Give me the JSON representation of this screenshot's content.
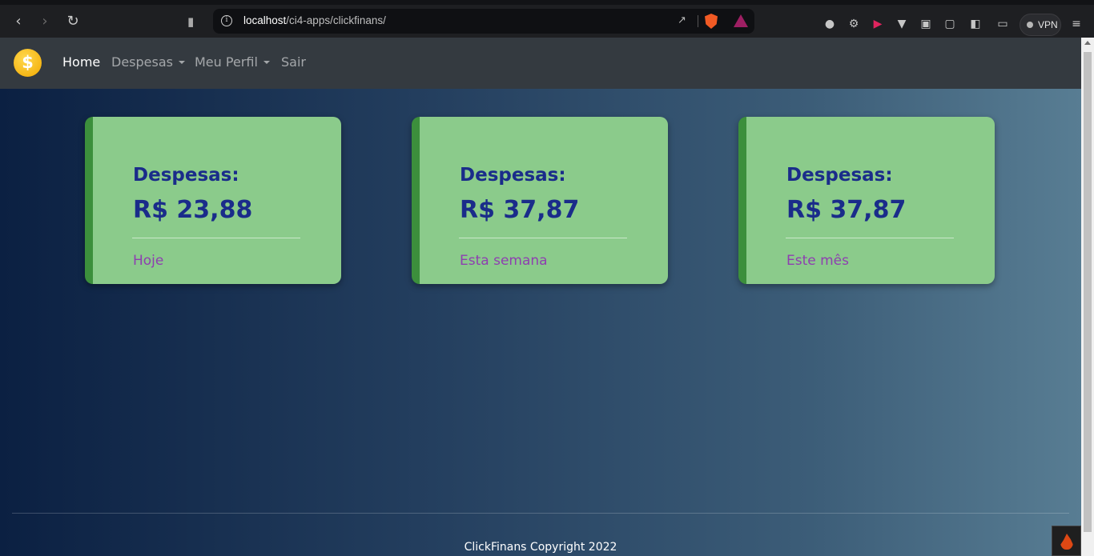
{
  "browser": {
    "url_host": "localhost",
    "url_path": "/ci4-apps/clickfinans/",
    "vpn_label": "VPN",
    "icons": [
      "back-icon",
      "forward-icon",
      "reload-icon",
      "bookmark-icon",
      "site-info-icon",
      "share-icon",
      "brave-shield-icon",
      "brave-rewards-icon",
      "extension-icon",
      "settings-icon",
      "media-icon",
      "vee-icon",
      "camera-icon",
      "puzzle-icon",
      "sidebar-icon",
      "wallet-icon",
      "menu-icon"
    ]
  },
  "navbar": {
    "logo_symbol": "$",
    "links": [
      {
        "label": "Home",
        "active": true,
        "dropdown": false
      },
      {
        "label": "Despesas",
        "active": false,
        "dropdown": true
      },
      {
        "label": "Meu Perfil",
        "active": false,
        "dropdown": true
      },
      {
        "label": "Sair",
        "active": false,
        "dropdown": false
      }
    ]
  },
  "cards": [
    {
      "title": "Despesas:",
      "value": "R$ 23,88",
      "period": "Hoje"
    },
    {
      "title": "Despesas:",
      "value": "R$ 37,87",
      "period": "Esta semana"
    },
    {
      "title": "Despesas:",
      "value": "R$ 37,87",
      "period": "Este mês"
    }
  ],
  "footer": {
    "text": "ClickFinans Copyright 2022"
  },
  "colors": {
    "card_background": "#8bcb8b",
    "card_accent": "#3c8f3c",
    "card_text": "#1a2c8a",
    "card_period": "#8e3fb0",
    "navbar": "#343a40"
  }
}
